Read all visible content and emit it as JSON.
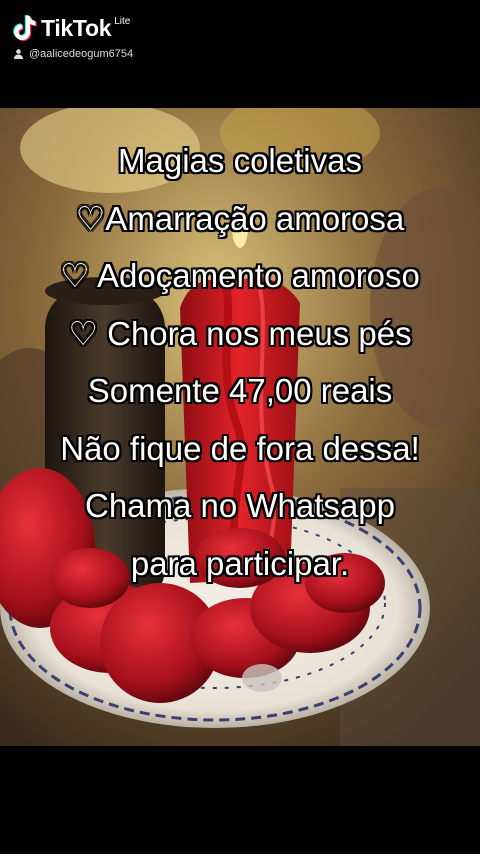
{
  "app": {
    "name": "TikTok",
    "badge": "Lite"
  },
  "user": {
    "handle": "@aalicedeogum6754"
  },
  "caption": {
    "lines": [
      "Magias coletivas",
      "♡Amarração amorosa",
      "♡ Adoçamento amoroso",
      "♡ Chora nos meus pés",
      "Somente 47,00 reais",
      "Não fique de fora dessa!",
      "Chama no Whatsapp",
      "para participar."
    ]
  },
  "colors": {
    "background": "#000000",
    "text": "#ffffff",
    "accent_red": "#c8102e"
  },
  "icons": {
    "logo": "tiktok-note-icon",
    "user": "person-icon"
  }
}
